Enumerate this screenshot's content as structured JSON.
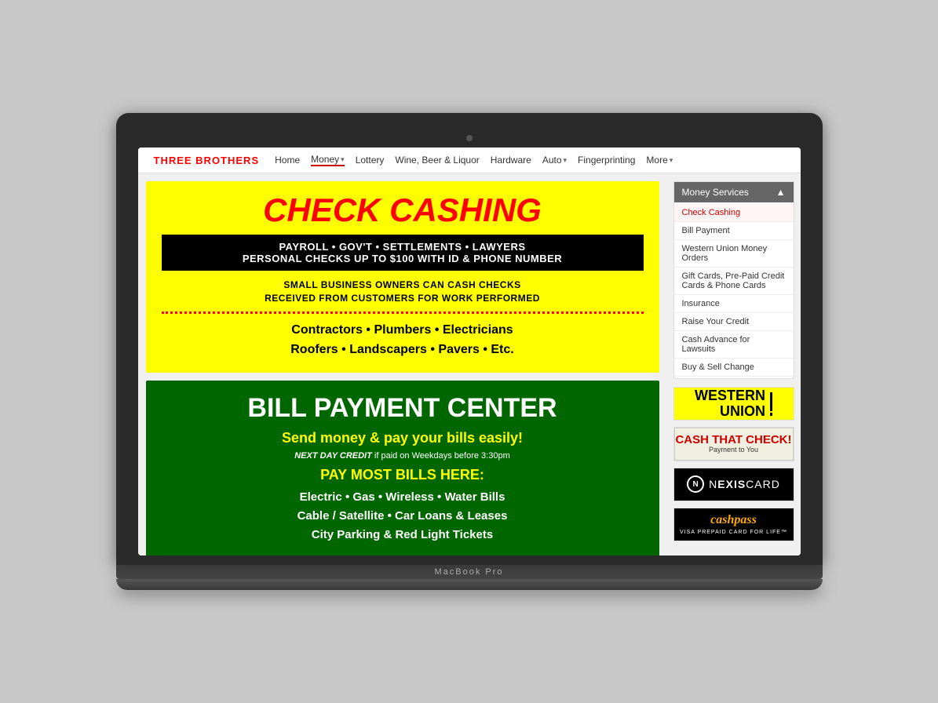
{
  "laptop": {
    "label": "MacBook Pro"
  },
  "navbar": {
    "brand": "THREE BROTHERS",
    "links": [
      {
        "label": "Home",
        "active": false,
        "has_dropdown": false
      },
      {
        "label": "Money",
        "active": true,
        "has_dropdown": true
      },
      {
        "label": "Lottery",
        "active": false,
        "has_dropdown": false
      },
      {
        "label": "Wine, Beer & Liquor",
        "active": false,
        "has_dropdown": false
      },
      {
        "label": "Hardware",
        "active": false,
        "has_dropdown": false
      },
      {
        "label": "Auto",
        "active": false,
        "has_dropdown": true
      },
      {
        "label": "Fingerprinting",
        "active": false,
        "has_dropdown": false
      },
      {
        "label": "More",
        "active": false,
        "has_dropdown": true
      }
    ]
  },
  "sidebar": {
    "menu_title": "Money Services",
    "items": [
      {
        "label": "Check Cashing",
        "active": true
      },
      {
        "label": "Bill Payment",
        "active": false
      },
      {
        "label": "Western Union Money Orders",
        "active": false
      },
      {
        "label": "Gift Cards, Pre-Paid Credit Cards & Phone Cards",
        "active": false
      },
      {
        "label": "Insurance",
        "active": false
      },
      {
        "label": "Raise Your Credit",
        "active": false
      },
      {
        "label": "Cash Advance for Lawsuits",
        "active": false
      },
      {
        "label": "Buy & Sell Change",
        "active": false
      }
    ],
    "logos": [
      {
        "name": "Western Union",
        "type": "western-union"
      },
      {
        "name": "Cash That Check",
        "type": "cash-that-check"
      },
      {
        "name": "NexisCard",
        "type": "nexiscard"
      },
      {
        "name": "CashPass",
        "type": "cashpass"
      }
    ]
  },
  "check_cashing": {
    "title": "CHECK CASHING",
    "subtitle_line1": "PAYROLL • GOV'T • SETTLEMENTS • LAWYERS",
    "subtitle_line2": "PERSONAL CHECKS UP TO $100 WITH ID & PHONE NUMBER",
    "desc_line1": "SMALL BUSINESS OWNERS CAN CASH CHECKS",
    "desc_line2": "RECEIVED FROM CUSTOMERS FOR WORK PERFORMED",
    "list_line1": "Contractors • Plumbers • Electricians",
    "list_line2": "Roofers • Landscapers • Pavers • Etc."
  },
  "bill_payment": {
    "title": "BILL PAYMENT CENTER",
    "subtitle": "Send money & pay your bills easily!",
    "credit_text": "NEXT DAY CREDIT",
    "credit_suffix": " if paid on Weekdays before 3:30pm",
    "list_title": "PAY MOST BILLS HERE:",
    "list_line1": "Electric • Gas • Wireless • Water Bills",
    "list_line2": "Cable / Satellite • Car Loans & Leases",
    "list_line3": "City Parking & Red Light Tickets"
  }
}
